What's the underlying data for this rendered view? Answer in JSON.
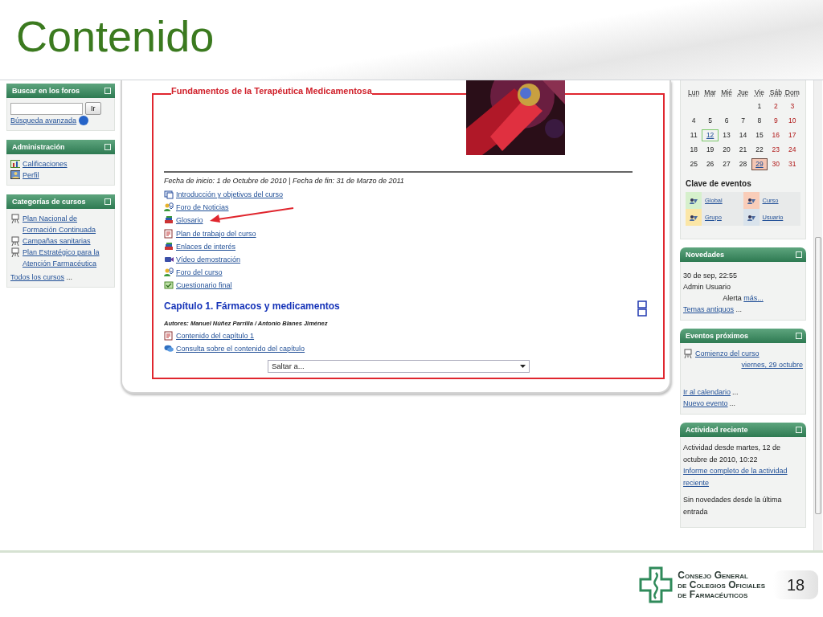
{
  "slide": {
    "title": "Contenido",
    "page_number": "18"
  },
  "left_blocks": [
    {
      "kind": "search",
      "title": "Buscar en los foros",
      "button": "Ir",
      "link": "Búsqueda avanzada"
    },
    {
      "kind": "links",
      "title": "Administración",
      "items": [
        {
          "label": "Calificaciones",
          "kind": "grades"
        },
        {
          "label": "Perfil",
          "kind": "profile"
        }
      ]
    },
    {
      "kind": "links",
      "title": "Categorías de cursos",
      "items": [
        {
          "label": "Plan Nacional de Formación Continuada",
          "kind": "category"
        },
        {
          "label": "Campañas sanitarias",
          "kind": "category"
        },
        {
          "label": "Plan Estratégico para la Atención Farmacéutica",
          "kind": "category"
        }
      ],
      "more_link": "Todos los cursos",
      "more_suffix": "..."
    }
  ],
  "course": {
    "title": "Fundamentos de la Terapéutica Medicamentosa",
    "dates": "Fecha de inicio: 1 de Octubre de 2010 | Fecha de fin: 31 de Marzo de 2011",
    "activities": [
      {
        "label": "Introducción y objetivos del curso",
        "kind": "resource"
      },
      {
        "label": "Foro de Noticias",
        "kind": "forum"
      },
      {
        "label": "Glosario",
        "kind": "glossary"
      },
      {
        "label": "Plan de trabajo del curso",
        "kind": "assignment"
      },
      {
        "label": "Enlaces de interés",
        "kind": "glossary"
      },
      {
        "label": "Vídeo demostración",
        "kind": "video"
      },
      {
        "label": "Foro del curso",
        "kind": "forum"
      },
      {
        "label": "Cuestionario final",
        "kind": "quiz"
      }
    ],
    "section": {
      "title": "Capítulo 1. Fármacos y medicamentos",
      "authors": "Autores: Manuel Núñez Parrilla / Antonio Blanes Jiménez",
      "activities": [
        {
          "label": "Contenido del capítulo 1",
          "kind": "assignment"
        },
        {
          "label": "Consulta sobre el contenido del capítulo",
          "kind": "chat"
        }
      ]
    },
    "jump_menu": "Saltar a..."
  },
  "calendar": {
    "weekdays": [
      "Lun",
      "Mar",
      "Mié",
      "Jue",
      "Vie",
      "Sáb",
      "Dom"
    ],
    "weeks": [
      [
        {
          "day": "1",
          "today": false,
          "event": false
        },
        {
          "day": "2",
          "today": false,
          "event": false
        },
        {
          "day": "3",
          "today": false,
          "event": false
        }
      ],
      [
        {
          "day": "4",
          "today": false,
          "event": false
        },
        {
          "day": "5",
          "today": false,
          "event": false
        },
        {
          "day": "6",
          "today": false,
          "event": false
        },
        {
          "day": "7",
          "today": false,
          "event": false
        },
        {
          "day": "8",
          "today": false,
          "event": false
        },
        {
          "day": "9",
          "today": false,
          "event": false
        },
        {
          "day": "10",
          "today": false,
          "event": false
        }
      ],
      [
        {
          "day": "11",
          "today": false,
          "event": false
        },
        {
          "day": "12",
          "today": true,
          "event": false
        },
        {
          "day": "13",
          "today": false,
          "event": false
        },
        {
          "day": "14",
          "today": false,
          "event": false
        },
        {
          "day": "15",
          "today": false,
          "event": false
        },
        {
          "day": "16",
          "today": false,
          "event": false
        },
        {
          "day": "17",
          "today": false,
          "event": false
        }
      ],
      [
        {
          "day": "18",
          "today": false,
          "event": false
        },
        {
          "day": "19",
          "today": false,
          "event": false
        },
        {
          "day": "20",
          "today": false,
          "event": false
        },
        {
          "day": "21",
          "today": false,
          "event": false
        },
        {
          "day": "22",
          "today": false,
          "event": false
        },
        {
          "day": "23",
          "today": false,
          "event": false
        },
        {
          "day": "24",
          "today": false,
          "event": false
        }
      ],
      [
        {
          "day": "25",
          "today": false,
          "event": false
        },
        {
          "day": "26",
          "today": false,
          "event": false
        },
        {
          "day": "27",
          "today": false,
          "event": false
        },
        {
          "day": "28",
          "today": false,
          "event": false
        },
        {
          "day": "29",
          "today": false,
          "event": true
        },
        {
          "day": "30",
          "today": false,
          "event": false
        },
        {
          "day": "31",
          "today": false,
          "event": false
        }
      ]
    ],
    "key_title": "Clave de eventos",
    "key": [
      {
        "label": "Global",
        "color": "#d6f0cc"
      },
      {
        "label": "Curso",
        "color": "#f9cdb9"
      },
      {
        "label": "Grupo",
        "color": "#fbe6a6"
      },
      {
        "label": "Usuario",
        "color": "#d9e3ec"
      }
    ]
  },
  "news": {
    "title": "Novedades",
    "date": "30 de sep, 22:55",
    "author": "Admin Usuario",
    "subject": "Alerta",
    "more": "más...",
    "older": "Temas antiguos",
    "older_suffix": "..."
  },
  "upcoming": {
    "title": "Eventos próximos",
    "event": "Comienzo del curso",
    "event_date": "viernes, 29 octubre",
    "links": [
      {
        "label": "Ir al calendario",
        "suffix": "..."
      },
      {
        "label": "Nuevo evento",
        "suffix": "..."
      }
    ]
  },
  "recent": {
    "title": "Actividad reciente",
    "since": "Actividad desde martes, 12 de octubre de 2010, 10:22",
    "report_link": "Informe completo de la actividad reciente",
    "note": "Sin novedades desde la última entrada"
  },
  "logo": {
    "lines": [
      "Consejo General",
      "de Colegios Oficiales",
      "de Farmacéuticos"
    ]
  }
}
